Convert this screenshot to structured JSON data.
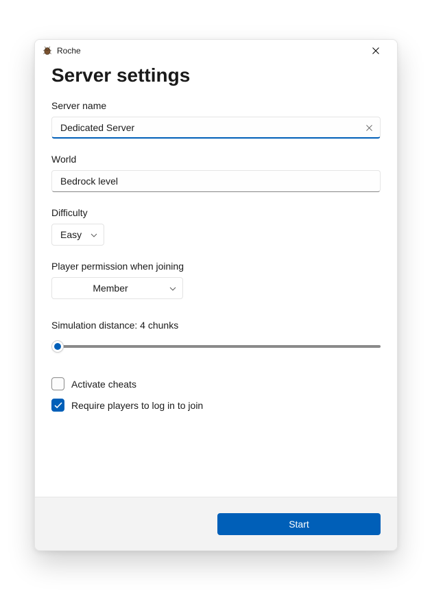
{
  "window": {
    "title": "Roche"
  },
  "page": {
    "title": "Server settings"
  },
  "fields": {
    "server_name": {
      "label": "Server name",
      "value": "Dedicated Server"
    },
    "world": {
      "label": "World",
      "value": "Bedrock level"
    },
    "difficulty": {
      "label": "Difficulty",
      "value": "Easy"
    },
    "permission": {
      "label": "Player permission when joining",
      "value": "Member"
    },
    "simulation": {
      "label": "Simulation distance: 4 chunks"
    },
    "cheats": {
      "label": "Activate cheats",
      "checked": false
    },
    "require_login": {
      "label": "Require players to log in to join",
      "checked": true
    }
  },
  "footer": {
    "start": "Start"
  }
}
